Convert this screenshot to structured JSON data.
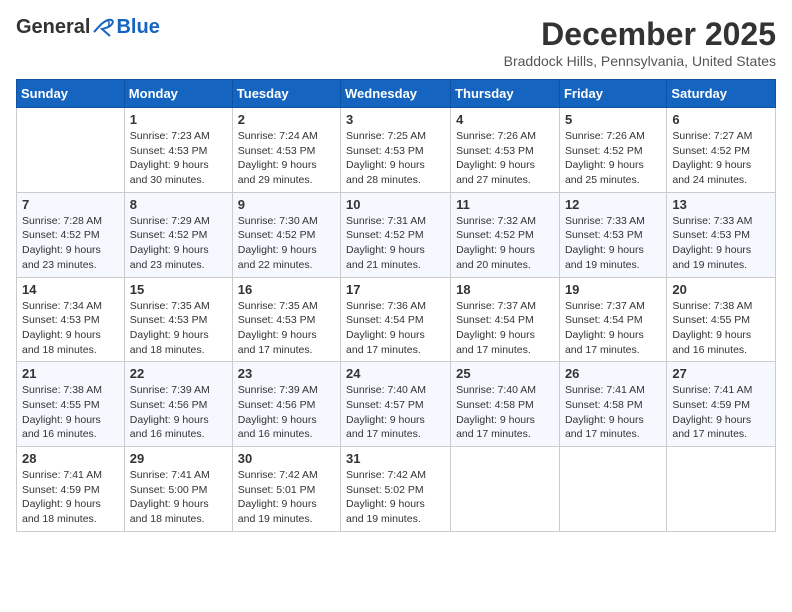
{
  "header": {
    "logo_general": "General",
    "logo_blue": "Blue",
    "month_title": "December 2025",
    "location": "Braddock Hills, Pennsylvania, United States"
  },
  "days_of_week": [
    "Sunday",
    "Monday",
    "Tuesday",
    "Wednesday",
    "Thursday",
    "Friday",
    "Saturday"
  ],
  "weeks": [
    [
      {
        "day": "",
        "info": ""
      },
      {
        "day": "1",
        "info": "Sunrise: 7:23 AM\nSunset: 4:53 PM\nDaylight: 9 hours\nand 30 minutes."
      },
      {
        "day": "2",
        "info": "Sunrise: 7:24 AM\nSunset: 4:53 PM\nDaylight: 9 hours\nand 29 minutes."
      },
      {
        "day": "3",
        "info": "Sunrise: 7:25 AM\nSunset: 4:53 PM\nDaylight: 9 hours\nand 28 minutes."
      },
      {
        "day": "4",
        "info": "Sunrise: 7:26 AM\nSunset: 4:53 PM\nDaylight: 9 hours\nand 27 minutes."
      },
      {
        "day": "5",
        "info": "Sunrise: 7:26 AM\nSunset: 4:52 PM\nDaylight: 9 hours\nand 25 minutes."
      },
      {
        "day": "6",
        "info": "Sunrise: 7:27 AM\nSunset: 4:52 PM\nDaylight: 9 hours\nand 24 minutes."
      }
    ],
    [
      {
        "day": "7",
        "info": "Sunrise: 7:28 AM\nSunset: 4:52 PM\nDaylight: 9 hours\nand 23 minutes."
      },
      {
        "day": "8",
        "info": "Sunrise: 7:29 AM\nSunset: 4:52 PM\nDaylight: 9 hours\nand 23 minutes."
      },
      {
        "day": "9",
        "info": "Sunrise: 7:30 AM\nSunset: 4:52 PM\nDaylight: 9 hours\nand 22 minutes."
      },
      {
        "day": "10",
        "info": "Sunrise: 7:31 AM\nSunset: 4:52 PM\nDaylight: 9 hours\nand 21 minutes."
      },
      {
        "day": "11",
        "info": "Sunrise: 7:32 AM\nSunset: 4:52 PM\nDaylight: 9 hours\nand 20 minutes."
      },
      {
        "day": "12",
        "info": "Sunrise: 7:33 AM\nSunset: 4:53 PM\nDaylight: 9 hours\nand 19 minutes."
      },
      {
        "day": "13",
        "info": "Sunrise: 7:33 AM\nSunset: 4:53 PM\nDaylight: 9 hours\nand 19 minutes."
      }
    ],
    [
      {
        "day": "14",
        "info": "Sunrise: 7:34 AM\nSunset: 4:53 PM\nDaylight: 9 hours\nand 18 minutes."
      },
      {
        "day": "15",
        "info": "Sunrise: 7:35 AM\nSunset: 4:53 PM\nDaylight: 9 hours\nand 18 minutes."
      },
      {
        "day": "16",
        "info": "Sunrise: 7:35 AM\nSunset: 4:53 PM\nDaylight: 9 hours\nand 17 minutes."
      },
      {
        "day": "17",
        "info": "Sunrise: 7:36 AM\nSunset: 4:54 PM\nDaylight: 9 hours\nand 17 minutes."
      },
      {
        "day": "18",
        "info": "Sunrise: 7:37 AM\nSunset: 4:54 PM\nDaylight: 9 hours\nand 17 minutes."
      },
      {
        "day": "19",
        "info": "Sunrise: 7:37 AM\nSunset: 4:54 PM\nDaylight: 9 hours\nand 17 minutes."
      },
      {
        "day": "20",
        "info": "Sunrise: 7:38 AM\nSunset: 4:55 PM\nDaylight: 9 hours\nand 16 minutes."
      }
    ],
    [
      {
        "day": "21",
        "info": "Sunrise: 7:38 AM\nSunset: 4:55 PM\nDaylight: 9 hours\nand 16 minutes."
      },
      {
        "day": "22",
        "info": "Sunrise: 7:39 AM\nSunset: 4:56 PM\nDaylight: 9 hours\nand 16 minutes."
      },
      {
        "day": "23",
        "info": "Sunrise: 7:39 AM\nSunset: 4:56 PM\nDaylight: 9 hours\nand 16 minutes."
      },
      {
        "day": "24",
        "info": "Sunrise: 7:40 AM\nSunset: 4:57 PM\nDaylight: 9 hours\nand 17 minutes."
      },
      {
        "day": "25",
        "info": "Sunrise: 7:40 AM\nSunset: 4:58 PM\nDaylight: 9 hours\nand 17 minutes."
      },
      {
        "day": "26",
        "info": "Sunrise: 7:41 AM\nSunset: 4:58 PM\nDaylight: 9 hours\nand 17 minutes."
      },
      {
        "day": "27",
        "info": "Sunrise: 7:41 AM\nSunset: 4:59 PM\nDaylight: 9 hours\nand 17 minutes."
      }
    ],
    [
      {
        "day": "28",
        "info": "Sunrise: 7:41 AM\nSunset: 4:59 PM\nDaylight: 9 hours\nand 18 minutes."
      },
      {
        "day": "29",
        "info": "Sunrise: 7:41 AM\nSunset: 5:00 PM\nDaylight: 9 hours\nand 18 minutes."
      },
      {
        "day": "30",
        "info": "Sunrise: 7:42 AM\nSunset: 5:01 PM\nDaylight: 9 hours\nand 19 minutes."
      },
      {
        "day": "31",
        "info": "Sunrise: 7:42 AM\nSunset: 5:02 PM\nDaylight: 9 hours\nand 19 minutes."
      },
      {
        "day": "",
        "info": ""
      },
      {
        "day": "",
        "info": ""
      },
      {
        "day": "",
        "info": ""
      }
    ]
  ]
}
